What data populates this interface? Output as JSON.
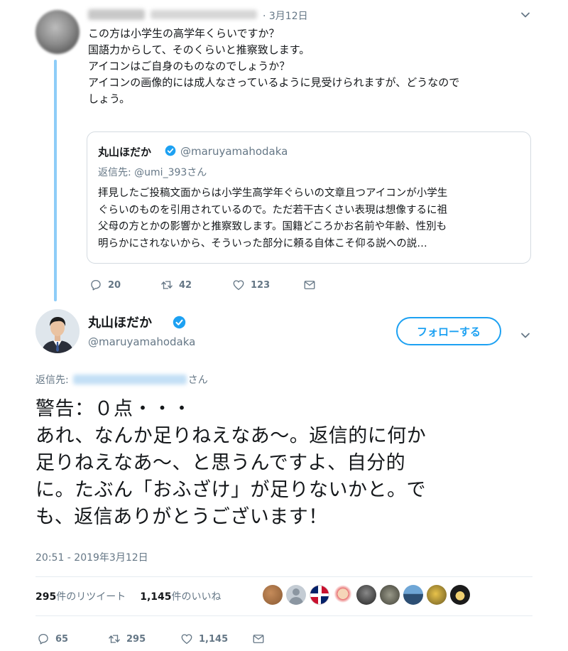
{
  "parent_tweet": {
    "date": "· 3月12日",
    "text_lines": [
      "この方は小学生の高学年くらいですか？",
      "国語力からして、そのくらいと推察致します。",
      "アイコンはご自身のものなのでしょうか？",
      "アイコンの画像的には成人なさっているように見受けられますが、どうなので",
      "しょう。"
    ],
    "quoted": {
      "name": "丸山ほだか",
      "handle": "@maruyamahodaka",
      "reply_to": "返信先: @umi_393さん",
      "text_lines": [
        "拝見したご投稿文面からは小学生高学年ぐらいの文章且つアイコンが小学生",
        "ぐらいのものを引用されているので。ただ若干古くさい表現は想像するに祖",
        "父母の方とかの影響かと推察致します。国籍どころかお名前や年齢、性別も",
        "明らかにされないから、そういった部分に頼る自体こそ仰る説への説…"
      ]
    },
    "actions": {
      "replies": "20",
      "retweets": "42",
      "likes": "123"
    }
  },
  "main_tweet": {
    "name": "丸山ほだか",
    "handle": "@maruyamahodaka",
    "follow_label": "フォローする",
    "reply_prefix": "返信先:",
    "reply_suffix": "さん",
    "text_lines": [
      "警告：０点・・・",
      "あれ、なんか足りねえなあ～。返信的に何か",
      "足りねえなあ～、と思うんですよ、自分的",
      "に。たぶん「おふざけ」が足りないかと。で",
      "も、返信ありがとうございます！"
    ],
    "timestamp": "20:51 - 2019年3月12日",
    "retweet_count": "295",
    "retweet_label": "件のリツイート",
    "like_count": "1,145",
    "like_label": "件のいいね",
    "actions": {
      "replies": "65",
      "retweets": "295",
      "likes": "1,145"
    }
  },
  "colors": {
    "accent": "#1da1f2",
    "thread_line": "#8ecdf8",
    "muted": "#657786"
  },
  "icons": [
    "chevron-down-icon",
    "verified-icon",
    "reply-icon",
    "retweet-icon",
    "like-icon",
    "dm-icon"
  ]
}
